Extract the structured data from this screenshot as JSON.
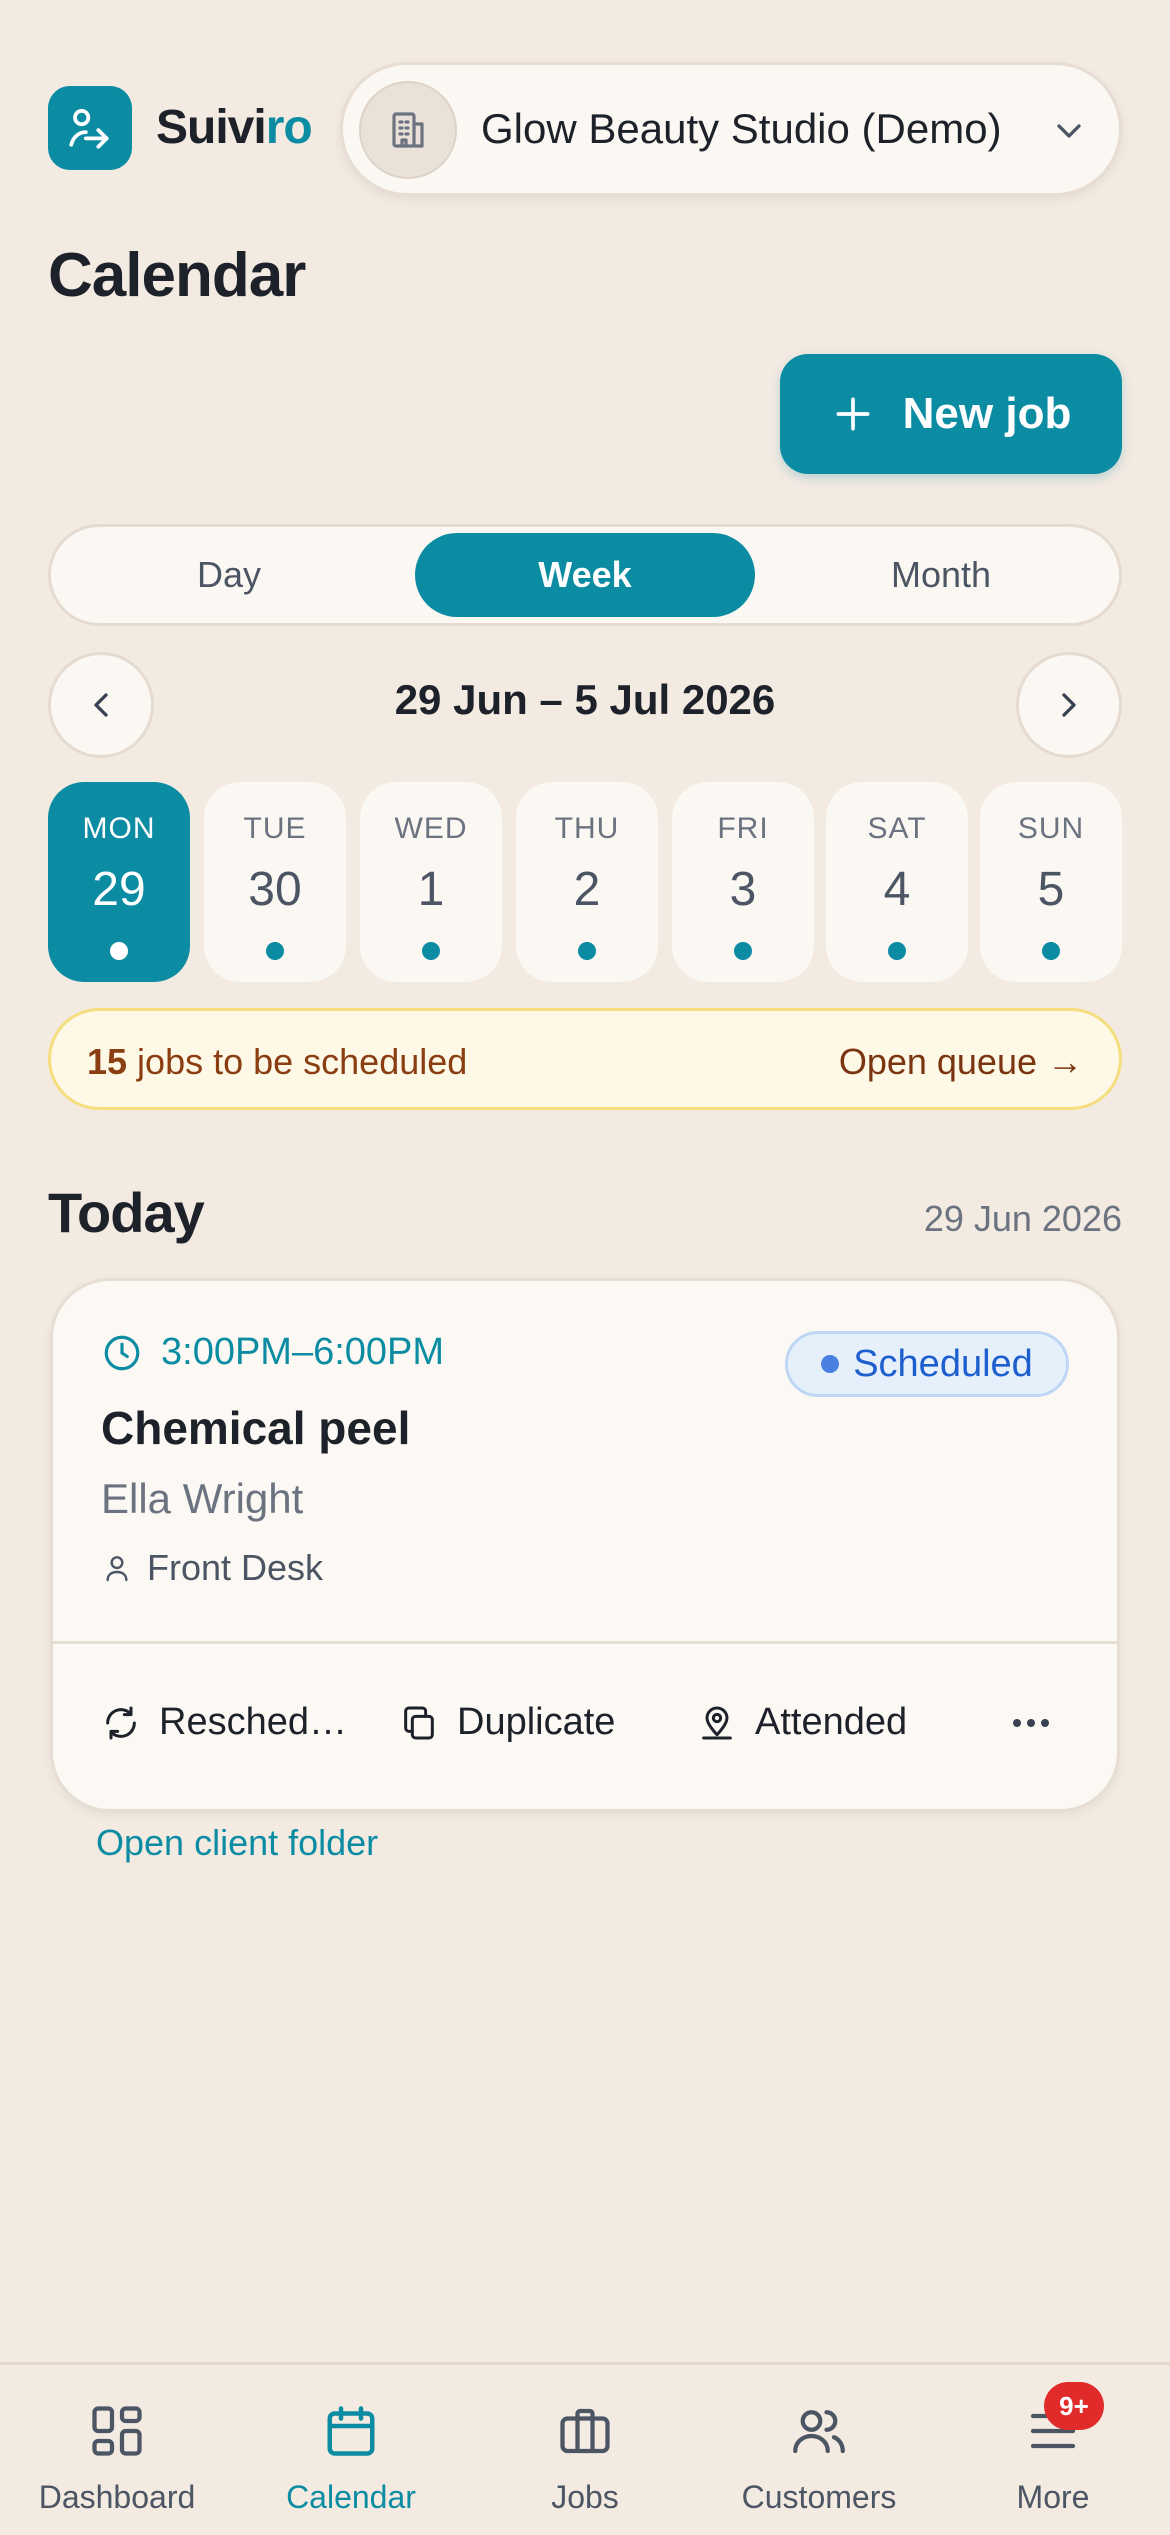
{
  "brand": {
    "name_part1": "Suivi",
    "name_part2": "ro",
    "accent": "#0C8CA3"
  },
  "studio_selector": {
    "name": "Glow Beauty Studio (Demo)",
    "icon": "building-icon"
  },
  "page": {
    "title": "Calendar"
  },
  "actions": {
    "new_job_label": "New job"
  },
  "view_toggle": {
    "options": [
      "Day",
      "Week",
      "Month"
    ],
    "selected": "Week"
  },
  "range": {
    "label": "29 Jun – 5 Jul 2026"
  },
  "days": [
    {
      "name": "MON",
      "date": "29",
      "active": true,
      "has_jobs": true
    },
    {
      "name": "TUE",
      "date": "30",
      "active": false,
      "has_jobs": true
    },
    {
      "name": "WED",
      "date": "1",
      "active": false,
      "has_jobs": true
    },
    {
      "name": "THU",
      "date": "2",
      "active": false,
      "has_jobs": true
    },
    {
      "name": "FRI",
      "date": "3",
      "active": false,
      "has_jobs": true
    },
    {
      "name": "SAT",
      "date": "4",
      "active": false,
      "has_jobs": true
    },
    {
      "name": "SUN",
      "date": "5",
      "active": false,
      "has_jobs": true
    }
  ],
  "queue": {
    "count": "15",
    "text": " jobs to be scheduled",
    "link": "Open queue →"
  },
  "today": {
    "title": "Today",
    "date": "29 Jun 2026",
    "appointment": {
      "time": "3:00PM–6:00PM",
      "status": "Scheduled",
      "service": "Chemical peel",
      "client": "Ella Wright",
      "assignee": "Front Desk",
      "actions": {
        "reschedule": "Resched…",
        "duplicate": "Duplicate",
        "attended": "Attended"
      }
    },
    "folder_link": "Open client folder"
  },
  "bottom_nav": {
    "tabs": [
      "Dashboard",
      "Calendar",
      "Jobs",
      "Customers",
      "More"
    ],
    "active": "Calendar",
    "more_badge": "9+"
  },
  "colors": {
    "background": "#F3EAE2",
    "accent": "#0C8CA3",
    "status_blue": "#1E5FCF",
    "badge_red": "#E12B2B"
  }
}
